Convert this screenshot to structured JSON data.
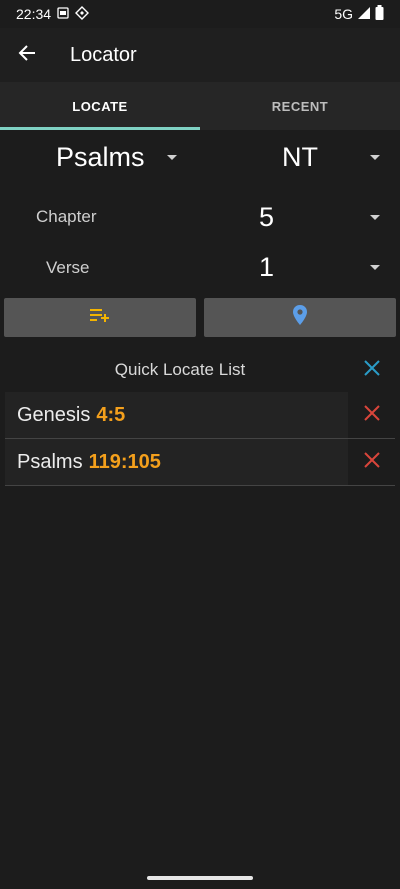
{
  "status": {
    "time": "22:34",
    "network": "5G"
  },
  "app": {
    "title": "Locator"
  },
  "tabs": [
    {
      "label": "LOCATE"
    },
    {
      "label": "RECENT"
    }
  ],
  "locate": {
    "book": "Psalms",
    "testament": "NT",
    "chapter_label": "Chapter",
    "chapter_value": "5",
    "verse_label": "Verse",
    "verse_value": "1"
  },
  "quick_list": {
    "title": "Quick Locate List",
    "items": [
      {
        "book": "Genesis",
        "ref": "4:5"
      },
      {
        "book": "Psalms",
        "ref": "119:105"
      }
    ]
  },
  "colors": {
    "accent": "#7fd1c3",
    "ref": "#f4a01c",
    "delete": "#d9453b",
    "clear": "#2a9cc7",
    "locate_pin": "#5c9ee8",
    "add_list": "#f4b400"
  },
  "icons": [
    "back-arrow-icon",
    "add-to-list-icon",
    "location-pin-icon",
    "close-icon",
    "caret-down-icon"
  ]
}
